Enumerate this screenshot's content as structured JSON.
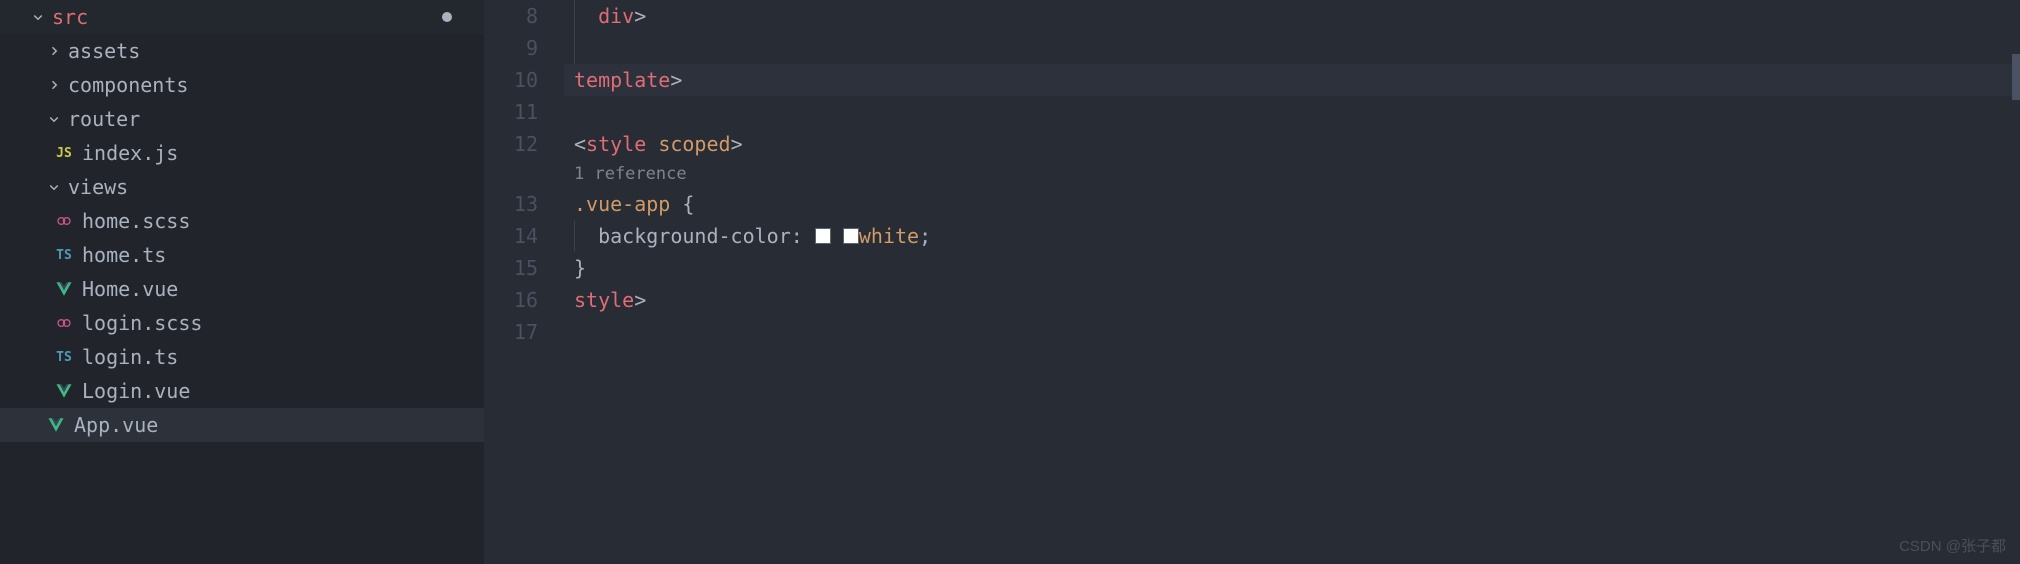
{
  "sidebar": {
    "items": [
      {
        "label": "src",
        "type": "folder",
        "expanded": true,
        "indent": 0,
        "dirty": true,
        "iconClass": "folder-src"
      },
      {
        "label": "assets",
        "type": "folder",
        "expanded": false,
        "indent": 1
      },
      {
        "label": "components",
        "type": "folder",
        "expanded": false,
        "indent": 1
      },
      {
        "label": "router",
        "type": "folder",
        "expanded": true,
        "indent": 1
      },
      {
        "label": "index.js",
        "type": "file",
        "indent": 2,
        "iconText": "JS",
        "iconClass": "icon-js"
      },
      {
        "label": "views",
        "type": "folder",
        "expanded": true,
        "indent": 1
      },
      {
        "label": "home.scss",
        "type": "file",
        "indent": 2,
        "iconSvg": "scss",
        "iconClass": "icon-scss"
      },
      {
        "label": "home.ts",
        "type": "file",
        "indent": 2,
        "iconText": "TS",
        "iconClass": "icon-ts"
      },
      {
        "label": "Home.vue",
        "type": "file",
        "indent": 2,
        "iconSvg": "vue",
        "iconClass": "icon-vue"
      },
      {
        "label": "login.scss",
        "type": "file",
        "indent": 2,
        "iconSvg": "scss",
        "iconClass": "icon-scss"
      },
      {
        "label": "login.ts",
        "type": "file",
        "indent": 2,
        "iconText": "TS",
        "iconClass": "icon-ts"
      },
      {
        "label": "Login.vue",
        "type": "file",
        "indent": 2,
        "iconSvg": "vue",
        "iconClass": "icon-vue"
      },
      {
        "label": "App.vue",
        "type": "file",
        "indent": 1,
        "iconSvg": "vue",
        "iconClass": "icon-vue",
        "selected": true
      }
    ]
  },
  "editor": {
    "reference_annotation": "1 reference",
    "lines": [
      {
        "num": "8",
        "guide": true,
        "tokens": [
          {
            "text": "  ",
            "cls": ""
          },
          {
            "text": "</",
            "cls": "tok-bracket"
          },
          {
            "text": "div",
            "cls": "tok-tag"
          },
          {
            "text": ">",
            "cls": "tok-bracket"
          }
        ]
      },
      {
        "num": "9",
        "guide": true,
        "tokens": []
      },
      {
        "num": "10",
        "highlighted": true,
        "tokens": [
          {
            "text": "</",
            "cls": "tok-bracket"
          },
          {
            "text": "template",
            "cls": "tok-tag"
          },
          {
            "text": ">",
            "cls": "tok-bracket"
          }
        ]
      },
      {
        "num": "11",
        "tokens": []
      },
      {
        "num": "12",
        "tokens": [
          {
            "text": "<",
            "cls": "tok-bracket"
          },
          {
            "text": "style",
            "cls": "tok-tag"
          },
          {
            "text": " ",
            "cls": ""
          },
          {
            "text": "scoped",
            "cls": "tok-attr"
          },
          {
            "text": ">",
            "cls": "tok-bracket"
          }
        ]
      },
      {
        "annotation": true
      },
      {
        "num": "13",
        "tokens": [
          {
            "text": ".vue-app",
            "cls": "tok-selector"
          },
          {
            "text": " ",
            "cls": ""
          },
          {
            "text": "{",
            "cls": "tok-punct"
          }
        ]
      },
      {
        "num": "14",
        "guide": true,
        "tokens": [
          {
            "text": "  ",
            "cls": ""
          },
          {
            "text": "background-color",
            "cls": "tok-prop"
          },
          {
            "text": ": ",
            "cls": "tok-punct"
          },
          {
            "swatch": true
          },
          {
            "text": " ",
            "cls": ""
          },
          {
            "swatch": true
          },
          {
            "text": "white",
            "cls": "tok-value"
          },
          {
            "text": ";",
            "cls": "tok-punct"
          }
        ]
      },
      {
        "num": "15",
        "tokens": [
          {
            "text": "}",
            "cls": "tok-punct"
          }
        ]
      },
      {
        "num": "16",
        "tokens": [
          {
            "text": "</",
            "cls": "tok-bracket"
          },
          {
            "text": "style",
            "cls": "tok-tag"
          },
          {
            "text": ">",
            "cls": "tok-bracket"
          }
        ]
      },
      {
        "num": "17",
        "tokens": []
      }
    ]
  },
  "watermark": "CSDN @张子都"
}
